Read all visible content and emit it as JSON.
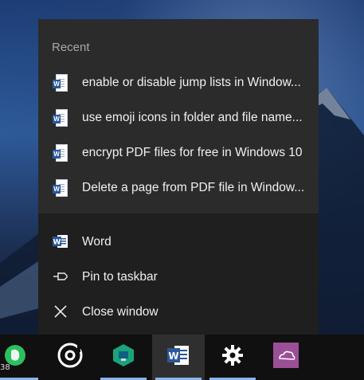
{
  "jumplist": {
    "recent_title": "Recent",
    "recent_items": [
      {
        "label": "enable or disable jump lists in Window...",
        "icon": "word-document-icon"
      },
      {
        "label": "use emoji icons in folder and file name...",
        "icon": "word-document-icon"
      },
      {
        "label": "encrypt PDF files for free in Windows 10",
        "icon": "word-document-icon"
      },
      {
        "label": "Delete a page from PDF file in Window...",
        "icon": "word-document-icon"
      }
    ],
    "tasks": [
      {
        "label": "Word",
        "icon": "word-app-icon"
      },
      {
        "label": "Pin to taskbar",
        "icon": "pin-icon"
      },
      {
        "label": "Close window",
        "icon": "close-icon"
      }
    ]
  },
  "taskbar": {
    "apps": [
      {
        "name": "evernote",
        "icon": "evernote-icon",
        "active": false
      },
      {
        "name": "groove",
        "icon": "groove-music-icon",
        "active": false
      },
      {
        "name": "network",
        "icon": "network-app-icon",
        "active": false
      },
      {
        "name": "word",
        "icon": "word-app-icon",
        "active": true
      },
      {
        "name": "settings",
        "icon": "gear-icon",
        "active": false
      },
      {
        "name": "onedrive",
        "icon": "onedrive-icon",
        "active": false
      }
    ],
    "clock_fragment": "38"
  },
  "colors": {
    "menu_bg": "#2b2b2b",
    "tasks_bg": "#1f1f1f",
    "taskbar_bg": "#101010",
    "accent_underline": "#8ab4e8",
    "word_blue": "#2b579a"
  }
}
